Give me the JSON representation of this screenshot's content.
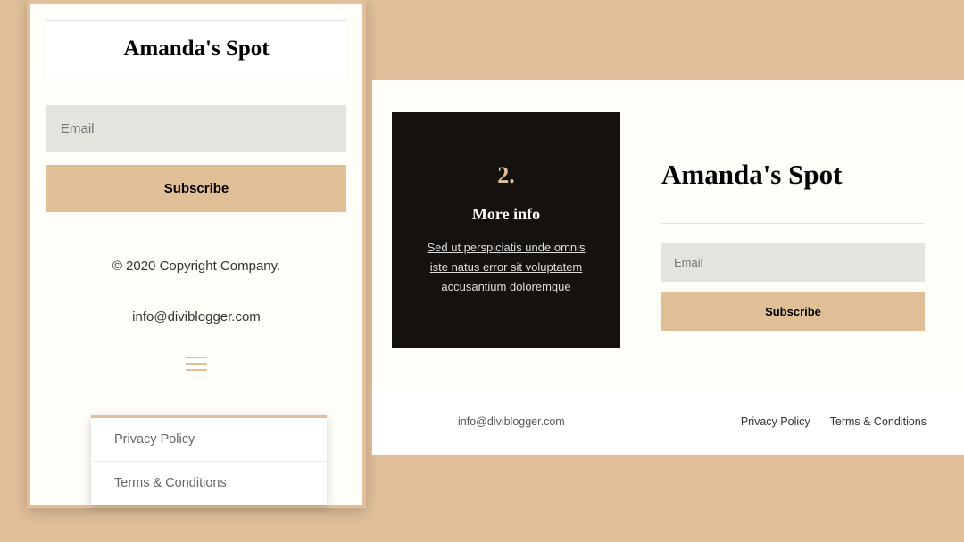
{
  "mobile": {
    "title": "Amanda's Spot",
    "email_placeholder": "Email",
    "subscribe_label": "Subscribe",
    "copyright": "© 2020 Copyright Company.",
    "contact_email": "info@diviblogger.com",
    "menu": {
      "items": [
        "Privacy Policy",
        "Terms & Conditions"
      ]
    }
  },
  "desktop": {
    "box": {
      "number": "2.",
      "heading": "More info",
      "body": "Sed ut perspiciatis unde omnis iste natus error sit voluptatem accusantium doloremque"
    },
    "title": "Amanda's Spot",
    "email_placeholder": "Email",
    "subscribe_label": "Subscribe",
    "contact_email": "info@diviblogger.com",
    "links": [
      "Privacy Policy",
      "Terms & Conditions"
    ]
  },
  "colors": {
    "background": "#e0bf9a",
    "accent": "#e0bf97",
    "dark_box": "#15110e",
    "input_bg": "#e4e3de",
    "panel": "#fefdf8"
  }
}
